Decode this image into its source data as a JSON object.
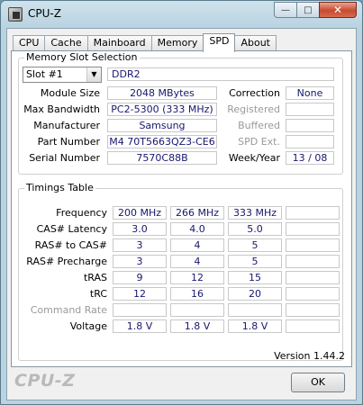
{
  "window": {
    "title": "CPU-Z"
  },
  "tabs": [
    "CPU",
    "Cache",
    "Mainboard",
    "Memory",
    "SPD",
    "About"
  ],
  "slot_group": {
    "legend": "Memory Slot Selection",
    "selected_slot": "Slot #1",
    "memory_type": "DDR2",
    "left_labels": [
      "Module Size",
      "Max Bandwidth",
      "Manufacturer",
      "Part Number",
      "Serial Number"
    ],
    "left_values": [
      "2048 MBytes",
      "PC2-5300 (333 MHz)",
      "Samsung",
      "M4 70T5663QZ3-CE6",
      "7570C88B"
    ],
    "right_labels": [
      "Correction",
      "Registered",
      "Buffered",
      "SPD Ext.",
      "Week/Year"
    ],
    "right_values": [
      "None",
      "",
      "",
      "",
      "13 / 08"
    ]
  },
  "timings": {
    "legend": "Timings Table",
    "rows": [
      {
        "label": "Frequency",
        "values": [
          "200 MHz",
          "266 MHz",
          "333 MHz",
          ""
        ]
      },
      {
        "label": "CAS# Latency",
        "values": [
          "3.0",
          "4.0",
          "5.0",
          ""
        ]
      },
      {
        "label": "RAS# to CAS#",
        "values": [
          "3",
          "4",
          "5",
          ""
        ]
      },
      {
        "label": "RAS# Precharge",
        "values": [
          "3",
          "4",
          "5",
          ""
        ]
      },
      {
        "label": "tRAS",
        "values": [
          "9",
          "12",
          "15",
          ""
        ]
      },
      {
        "label": "tRC",
        "values": [
          "12",
          "16",
          "20",
          ""
        ]
      },
      {
        "label": "Command Rate",
        "values": [
          "",
          "",
          "",
          ""
        ]
      },
      {
        "label": "Voltage",
        "values": [
          "1.8 V",
          "1.8 V",
          "1.8 V",
          ""
        ]
      }
    ]
  },
  "footer": {
    "logo": "CPU-Z",
    "version": "Version 1.44.2",
    "ok_label": "OK"
  },
  "colors": {
    "value_text": "#17176e",
    "disabled_text": "#9a9a9a",
    "close_button": "#c74a2f"
  },
  "icons": {
    "app": "cpuz-chip-icon",
    "minimize": "minimize-icon",
    "maximize": "maximize-icon",
    "close": "close-icon",
    "dropdown": "chevron-down-icon"
  }
}
